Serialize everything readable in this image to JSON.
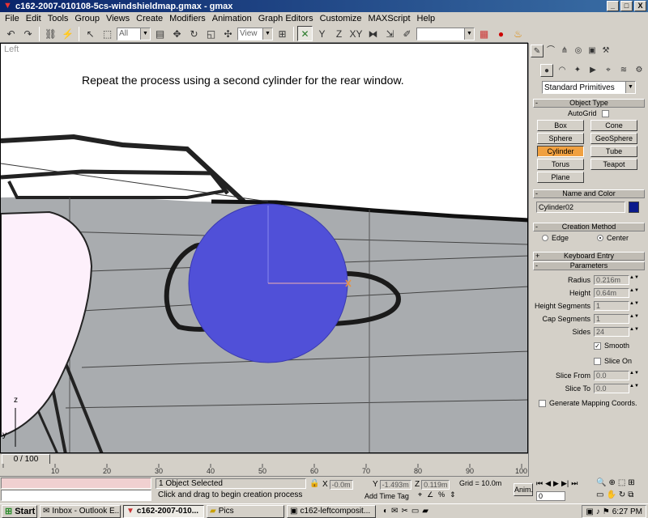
{
  "window": {
    "title": "c162-2007-010108-5cs-windshieldmap.gmax - gmax",
    "btn_min": "_",
    "btn_max": "□",
    "btn_close": "X"
  },
  "menu": [
    "File",
    "Edit",
    "Tools",
    "Group",
    "Views",
    "Create",
    "Modifiers",
    "Animation",
    "Graph Editors",
    "Customize",
    "MAXScript",
    "Help"
  ],
  "toolbar": {
    "filter_value": "All",
    "coord_value": "View"
  },
  "viewport": {
    "label": "Left",
    "caption": "Repeat the process using a second cylinder for the rear window.",
    "axis_z": "z",
    "axis_y": "y"
  },
  "timeline": {
    "slider": "0 / 100",
    "ticks": [
      "10",
      "20",
      "30",
      "40",
      "50",
      "60",
      "70",
      "80",
      "90",
      "100"
    ]
  },
  "panel": {
    "category": "Standard Primitives",
    "object_type_title": "Object Type",
    "autogrid_label": "AutoGrid",
    "buttons": [
      "Box",
      "Cone",
      "Sphere",
      "GeoSphere",
      "Cylinder",
      "Tube",
      "Torus",
      "Teapot",
      "Plane"
    ],
    "active_button": "Cylinder",
    "name_color_title": "Name and Color",
    "object_name": "Cylinder02",
    "object_color": "#0a1a8c",
    "creation_method_title": "Creation Method",
    "creation_edge": "Edge",
    "creation_center": "Center",
    "keyboard_entry_title": "Keyboard Entry",
    "parameters_title": "Parameters",
    "radius_label": "Radius",
    "radius": "0.216m",
    "height_label": "Height",
    "height": "0.64m",
    "height_segments_label": "Height Segments",
    "height_segments": "1",
    "cap_segments_label": "Cap Segments",
    "cap_segments": "1",
    "sides_label": "Sides",
    "sides": "24",
    "smooth_label": "Smooth",
    "slice_on_label": "Slice On",
    "slice_from_label": "Slice From",
    "slice_from": "0.0",
    "slice_to_label": "Slice To",
    "slice_to": "0.0",
    "gen_mapping_label": "Generate Mapping Coords."
  },
  "status": {
    "selection": "1 Object Selected",
    "prompt": "Click and drag to begin creation process",
    "x_label": "X",
    "x_value": "-0.0m",
    "y_label": "Y",
    "y_value": "-1.493m",
    "z_label": "Z",
    "z_value": "0.119m",
    "grid": "Grid = 10.0m",
    "add_time_tag": "Add Time Tag",
    "anim": "Anim.",
    "frame": "0"
  },
  "taskbar": {
    "start": "Start",
    "tasks": [
      "Inbox - Outlook E...",
      "c162-2007-010...",
      "Pics",
      "c162-leftcomposit..."
    ],
    "active_task": 1,
    "clock": "6:27 PM"
  }
}
